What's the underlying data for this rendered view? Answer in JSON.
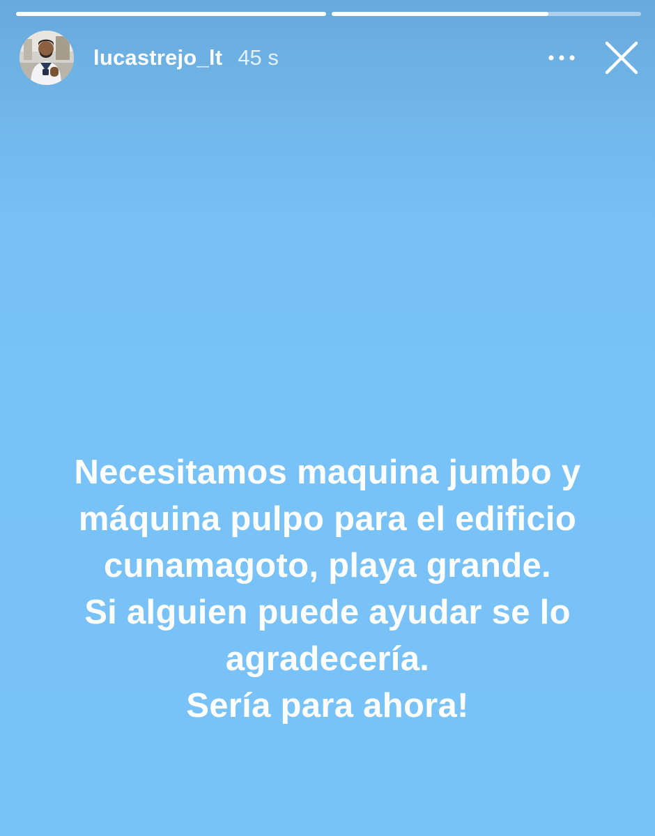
{
  "progress": {
    "segments": [
      {
        "fill": 1.0
      },
      {
        "fill": 0.7
      }
    ]
  },
  "header": {
    "username": "lucastrejo_lt",
    "time": "45 s",
    "icons": {
      "avatar": "profile-photo",
      "more": "more-horizontal-icon",
      "close": "close-icon"
    }
  },
  "story": {
    "background_color": "#78c3f8",
    "text_color": "#ffffff",
    "lines": [
      "Necesitamos maquina jumbo y",
      "máquina pulpo para el edificio",
      "cunamagoto, playa grande.",
      "Si alguien puede ayudar se lo",
      "agradecería.",
      "Sería para ahora!"
    ]
  }
}
